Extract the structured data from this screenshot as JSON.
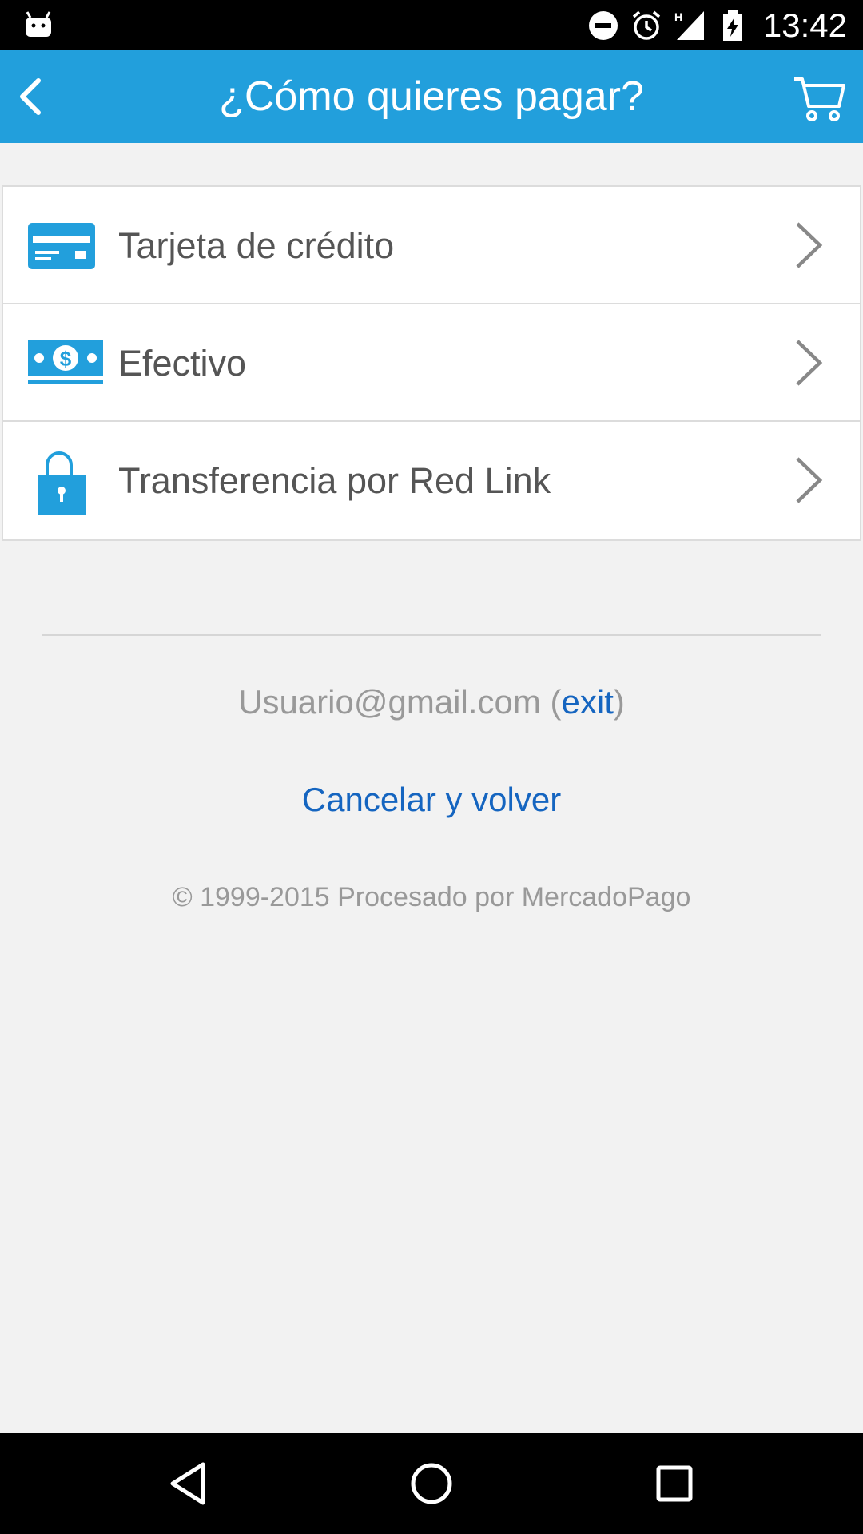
{
  "status_bar": {
    "time": "13:42",
    "network_type": "H",
    "icons": [
      "android-icon",
      "do-not-disturb-icon",
      "alarm-icon",
      "signal-icon",
      "battery-charging-icon"
    ]
  },
  "app_bar": {
    "title": "¿Cómo quieres pagar?",
    "back_icon": "chevron-left-icon",
    "cart_icon": "shopping-cart-icon",
    "background": "#229fdc"
  },
  "payment_methods": [
    {
      "label": "Tarjeta de crédito",
      "icon": "credit-card-icon"
    },
    {
      "label": "Efectivo",
      "icon": "cash-icon"
    },
    {
      "label": "Transferencia por Red Link",
      "icon": "lock-icon"
    }
  ],
  "footer": {
    "email": "Usuario@gmail.com",
    "paren_open": " (",
    "exit_label": "exit",
    "paren_close": ")",
    "cancel_label": "Cancelar y volver",
    "copyright": "© 1999-2015 Procesado por MercadoPago"
  },
  "nav_bar": {
    "icons": [
      "back-triangle-icon",
      "home-circle-icon",
      "recents-square-icon"
    ]
  },
  "colors": {
    "accent": "#229fdc",
    "link": "#1565c0",
    "background": "#f2f2f2"
  }
}
